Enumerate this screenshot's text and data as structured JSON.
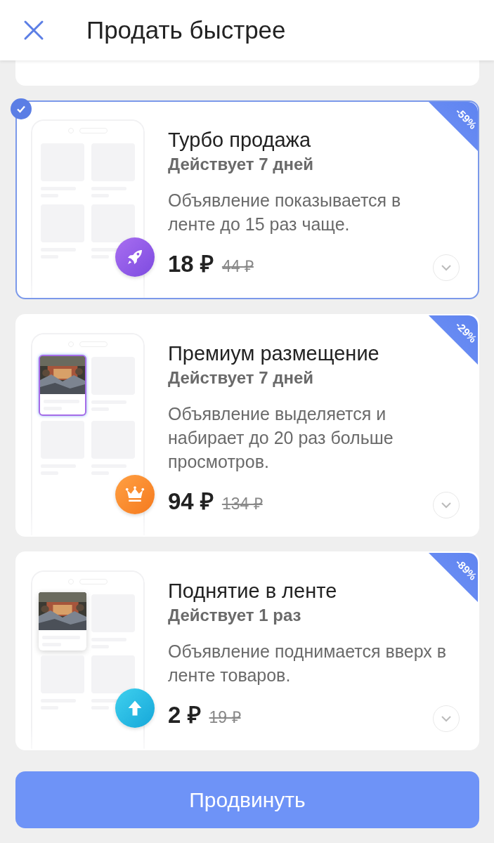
{
  "header": {
    "title": "Продать быстрее"
  },
  "options": [
    {
      "kind": "turbo",
      "title": "Турбо продажа",
      "duration": "Действует 7 дней",
      "description": "Объявление показывается в ленте до 15 раз чаще.",
      "price": "18 ₽",
      "old_price": "44 ₽",
      "discount": "-59%",
      "selected": true
    },
    {
      "kind": "premium",
      "title": "Премиум размещение",
      "duration": "Действует 7 дней",
      "description": "Объявление выделяется и набирает до 20 раз больше просмотров.",
      "price": "94 ₽",
      "old_price": "134 ₽",
      "discount": "-29%",
      "selected": false
    },
    {
      "kind": "lift",
      "title": "Поднятие в ленте",
      "duration": "Действует 1 раз",
      "description": "Объявление поднимается вверх в ленте товаров.",
      "price": "2 ₽",
      "old_price": "19 ₽",
      "discount": "-89%",
      "selected": false
    }
  ],
  "action": {
    "label": "Продвинуть"
  }
}
